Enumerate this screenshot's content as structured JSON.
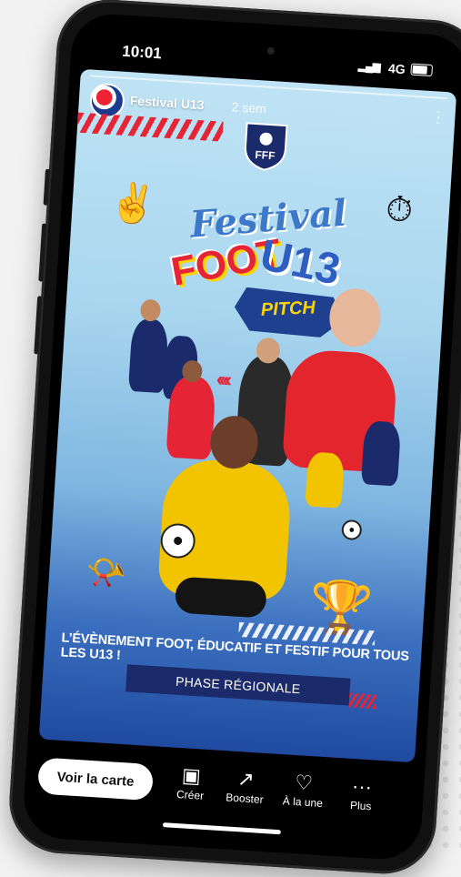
{
  "status_bar": {
    "time": "10:01",
    "network": "4G"
  },
  "story": {
    "account_name": "Festival U13",
    "age": "2 sem",
    "logo_text": "FFF",
    "title_line1": "Festival",
    "title_line2_a": "FOOT",
    "title_line2_b": "U13",
    "badge": "PITCH",
    "tagline": "L’ÉVÈNEMENT FOOT, ÉDUCATIF ET FESTIF POUR TOUS LES U13 !",
    "phase": "PHASE RÉGIONALE"
  },
  "actions": {
    "primary": "Voir la carte",
    "items": [
      {
        "label": "Créer",
        "icon": "create-icon"
      },
      {
        "label": "Booster",
        "icon": "trend-icon"
      },
      {
        "label": "À la une",
        "icon": "highlight-icon"
      },
      {
        "label": "Plus",
        "icon": "more-icon"
      }
    ]
  },
  "colors": {
    "accent_red": "#e52436",
    "navy": "#1b2a6b",
    "yellow": "#ffd400"
  }
}
